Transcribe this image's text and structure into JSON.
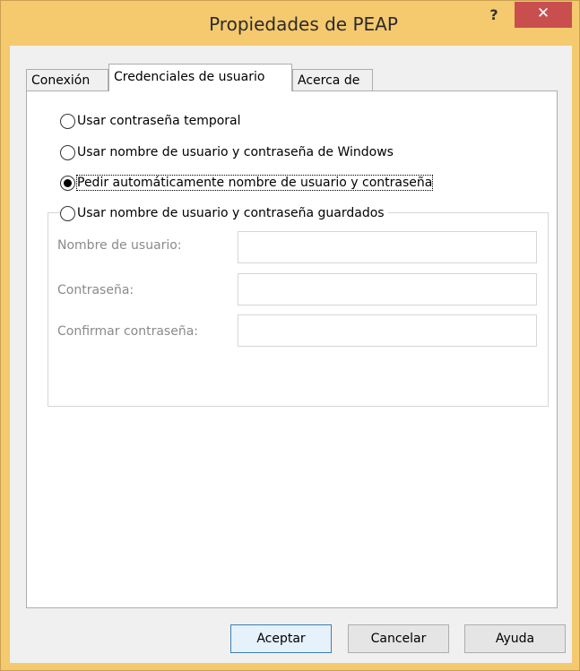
{
  "window": {
    "title": "Propiedades de PEAP",
    "help_label": "?",
    "close_label": "✕"
  },
  "tabs": [
    {
      "label": "Conexión"
    },
    {
      "label": "Credenciales de usuario"
    },
    {
      "label": "Acerca de"
    }
  ],
  "options": [
    {
      "label": "Usar contraseña temporal",
      "checked": false
    },
    {
      "label": "Usar nombre de usuario y contraseña de Windows",
      "checked": false
    },
    {
      "label": "Pedir automáticamente nombre de usuario y contraseña",
      "checked": true
    },
    {
      "label": "Usar nombre de usuario y contraseña guardados",
      "checked": false
    }
  ],
  "fields": [
    {
      "label": "Nombre de usuario:",
      "value": ""
    },
    {
      "label": "Contraseña:",
      "value": ""
    },
    {
      "label": "Confirmar contraseña:",
      "value": ""
    }
  ],
  "buttons": {
    "accept": "Aceptar",
    "cancel": "Cancelar",
    "help": "Ayuda"
  }
}
